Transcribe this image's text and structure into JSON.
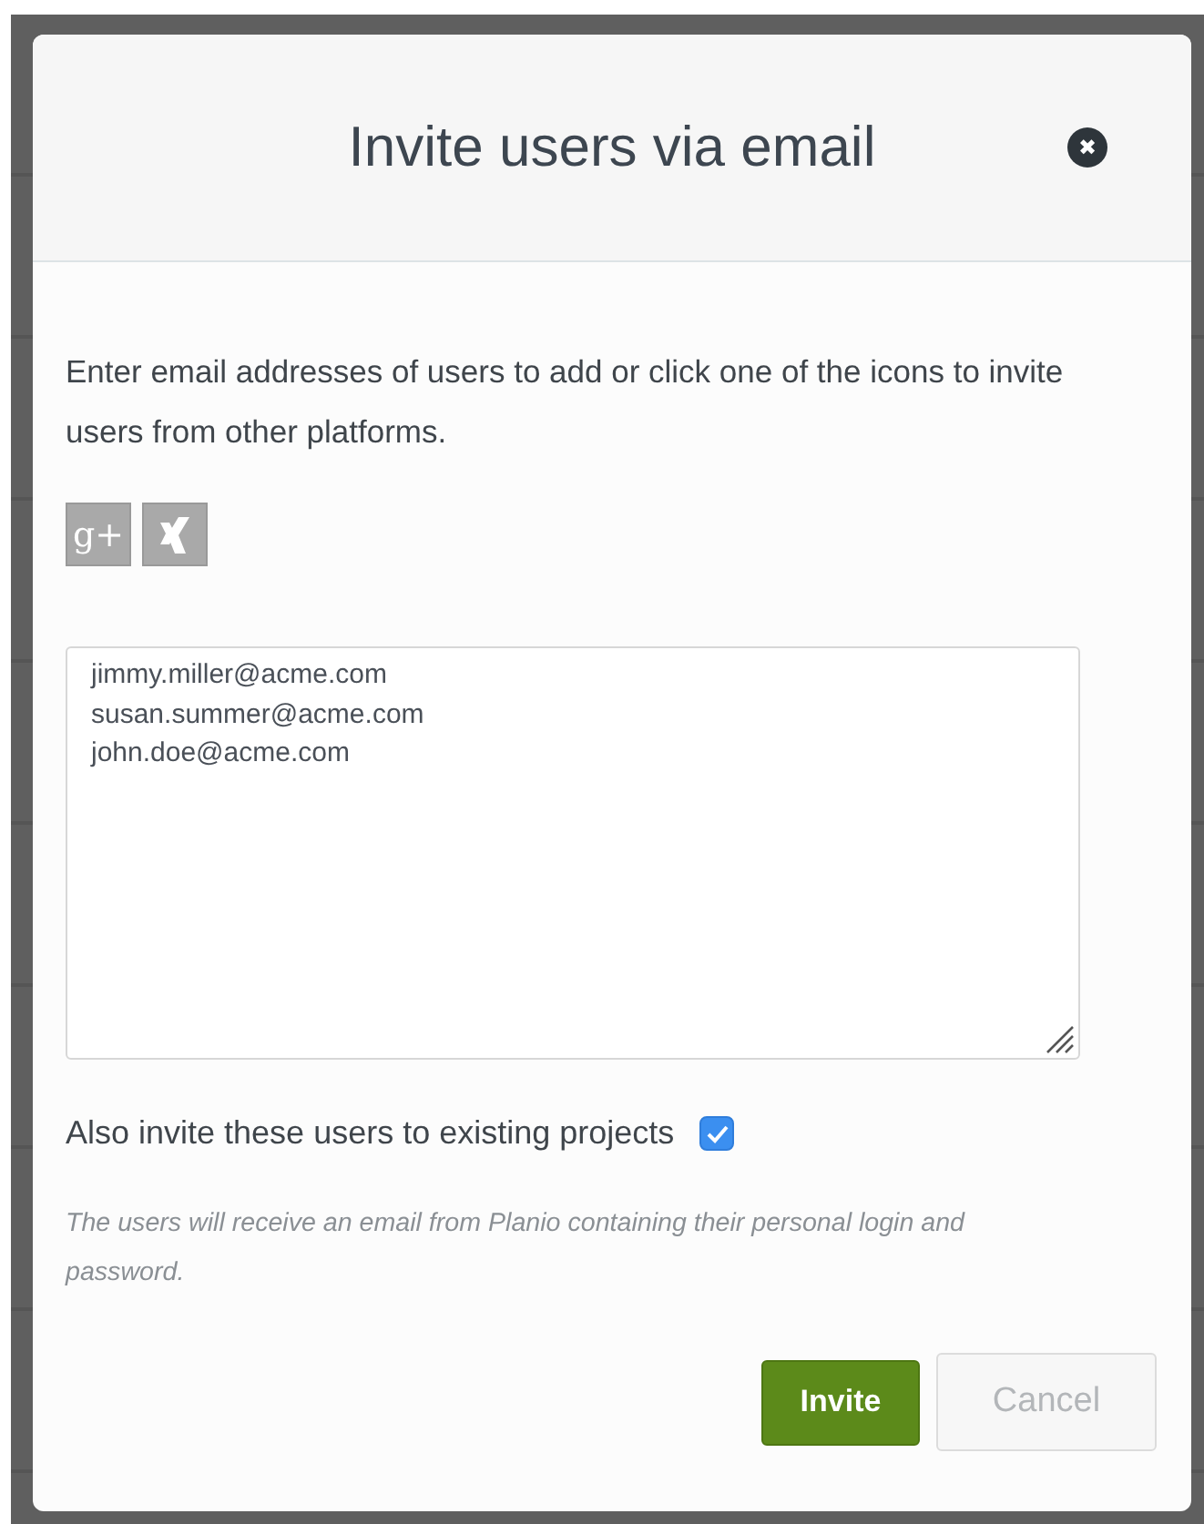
{
  "dialog": {
    "title": "Invite users via email",
    "close_icon": "✖"
  },
  "description": "Enter email addresses of users to add or click one of the icons to invite users from other platforms.",
  "platforms": [
    {
      "kind": "googleplus",
      "label": "g+"
    },
    {
      "kind": "xing"
    }
  ],
  "emails": [
    "jimmy.miller@acme.com",
    "susan.summer@acme.com",
    "john.doe@acme.com"
  ],
  "existing_projects": {
    "label": "Also invite these users to existing projects",
    "checked": true
  },
  "note": "The users will receive an email from Planio containing their personal login and password.",
  "buttons": [
    {
      "kind": "primary",
      "label": "Invite"
    },
    {
      "kind": "secondary",
      "label": "Cancel"
    }
  ]
}
